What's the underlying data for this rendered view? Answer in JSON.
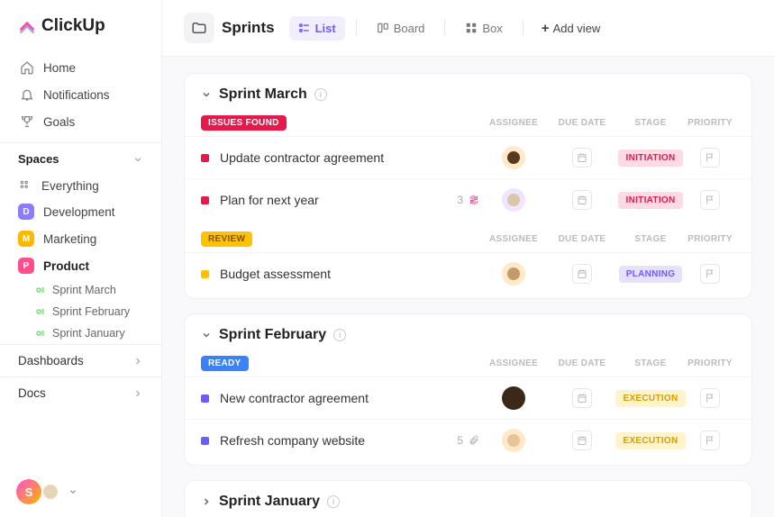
{
  "logo": "ClickUp",
  "nav": {
    "home": "Home",
    "notifications": "Notifications",
    "goals": "Goals"
  },
  "spaces": {
    "header": "Spaces",
    "everything": "Everything",
    "items": [
      {
        "letter": "D",
        "color": "#8b7bff",
        "label": "Development"
      },
      {
        "letter": "M",
        "color": "#ffb800",
        "label": "Marketing"
      },
      {
        "letter": "P",
        "color": "#ff4e8b",
        "label": "Product"
      }
    ],
    "subs": [
      {
        "label": "Sprint  March"
      },
      {
        "label": "Sprint  February"
      },
      {
        "label": "Sprint January"
      }
    ]
  },
  "sections": {
    "dashboards": "Dashboards",
    "docs": "Docs"
  },
  "user": {
    "initial": "S"
  },
  "topbar": {
    "title": "Sprints",
    "views": {
      "list": "List",
      "board": "Board",
      "box": "Box",
      "add": "Add view"
    }
  },
  "columns": {
    "assignee": "ASSIGNEE",
    "duedate": "DUE DATE",
    "stage": "STAGE",
    "priority": "PRIORITY"
  },
  "sprints": [
    {
      "title": "Sprint March",
      "groups": [
        {
          "status": "ISSUES FOUND",
          "statusColor": "#e6194b",
          "tasks": [
            {
              "square": "#e6194b",
              "name": "Update contractor agreement",
              "avatarBg": "#ffe9c9",
              "avatarInner": "#5a3a1f",
              "stage": "INITIATION",
              "stageBg": "#ffd9e4",
              "stageColor": "#e6194b"
            },
            {
              "square": "#e6194b",
              "name": "Plan for next year",
              "meta": "3",
              "hasLoop": true,
              "avatarBg": "#f0e4ff",
              "avatarInner": "#d8c7a8",
              "stage": "INITIATION",
              "stageBg": "#ffd9e4",
              "stageColor": "#e6194b"
            }
          ]
        },
        {
          "status": "REVIEW",
          "statusColor": "#ffc107",
          "tasks": [
            {
              "square": "#ffc107",
              "name": "Budget assessment",
              "avatarBg": "#ffe9c9",
              "avatarInner": "#c49a6c",
              "stage": "PLANNING",
              "stageBg": "#e8e0ff",
              "stageColor": "#6b5cff"
            }
          ]
        }
      ]
    },
    {
      "title": "Sprint February",
      "groups": [
        {
          "status": "READY",
          "statusColor": "#3b82f6",
          "tasks": [
            {
              "square": "#6b5cff",
              "name": "New contractor agreement",
              "avatarBg": "#3a2818",
              "avatarInner": "#3a2818",
              "stage": "EXECUTION",
              "stageBg": "#fff3cc",
              "stageColor": "#d4a000"
            },
            {
              "square": "#6b5cff",
              "name": "Refresh company website",
              "meta": "5",
              "hasAttach": true,
              "avatarBg": "#ffe9c9",
              "avatarInner": "#e8c49a",
              "stage": "EXECUTION",
              "stageBg": "#fff3cc",
              "stageColor": "#d4a000"
            }
          ]
        }
      ]
    }
  ],
  "collapsed_sprint": "Sprint January"
}
